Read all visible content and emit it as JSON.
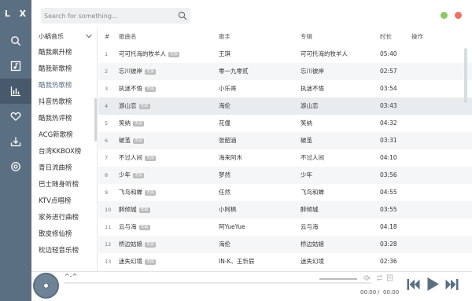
{
  "app": {
    "logo": "L X"
  },
  "nav": {
    "items": [
      "search",
      "song-list",
      "leaderboard",
      "favorites",
      "download",
      "settings"
    ]
  },
  "search": {
    "placeholder": "Search for something..."
  },
  "board": {
    "source": "小蜗音乐",
    "items": [
      "酷我飙升榜",
      "酷我新歌榜",
      "酷我热歌榜",
      "抖音热歌榜",
      "酷我热评榜",
      "ACG新歌榜",
      "台湾KKBOX榜",
      "青日流曲榜",
      "巴士随身听榜",
      "KTV点唱榜",
      "家务进行曲榜",
      "散皮修仙榜",
      "枕边轻音乐榜"
    ]
  },
  "table": {
    "headers": {
      "index": "#",
      "name": "歌曲名",
      "singer": "歌手",
      "album": "专辑",
      "duration": "时长",
      "ops": "操作"
    },
    "tag": "无损",
    "rows": [
      {
        "index": "1",
        "name": "可可托海的牧羊人",
        "tag": true,
        "singer": "王琪",
        "album": "可可托海的牧羊人",
        "duration": "05:40"
      },
      {
        "index": "2",
        "name": "忘川彼岸",
        "tag": true,
        "singer": "零一九零贰",
        "album": "忘川彼岸",
        "duration": "02:57"
      },
      {
        "index": "3",
        "name": "执迷不悟",
        "tag": true,
        "singer": "小乐哥",
        "album": "执迷不悟",
        "duration": "03:54"
      },
      {
        "index": "4",
        "name": "游山恋",
        "tag": true,
        "singer": "海伦",
        "album": "游山恋",
        "duration": "03:43"
      },
      {
        "index": "5",
        "name": "笑纳",
        "tag": true,
        "singer": "花僮",
        "album": "笑纳",
        "duration": "04:32"
      },
      {
        "index": "6",
        "name": "破茧",
        "tag": true,
        "singer": "张韶涵",
        "album": "破茧",
        "duration": "03:31"
      },
      {
        "index": "7",
        "name": "不过人间",
        "tag": true,
        "singer": "海来阿木",
        "album": "不过人间",
        "duration": "04:10"
      },
      {
        "index": "8",
        "name": "少年",
        "tag": true,
        "singer": "梦然",
        "album": "少年",
        "duration": "03:56"
      },
      {
        "index": "9",
        "name": "飞鸟和蝉",
        "tag": true,
        "singer": "任然",
        "album": "飞鸟和蝉",
        "duration": "04:55"
      },
      {
        "index": "10",
        "name": "醉倾城",
        "tag": true,
        "singer": "小阿枫",
        "album": "醉倾城",
        "duration": "03:55"
      },
      {
        "index": "11",
        "name": "云与海",
        "tag": true,
        "singer": "阿YueYue",
        "album": "云与海",
        "duration": "04:18"
      },
      {
        "index": "12",
        "name": "桥边姑娘",
        "tag": true,
        "singer": "海伦",
        "album": "桥边姑娘",
        "duration": "03:28"
      },
      {
        "index": "13",
        "name": "迷失幻境",
        "tag": true,
        "singer": "IN-K、王忻辰",
        "album": "迷失幻境",
        "duration": "02:36"
      }
    ]
  },
  "player": {
    "title": "^-^",
    "time_current": "00:00",
    "time_sep": "/",
    "time_total": "00:00",
    "progress": 0
  },
  "colors": {
    "sidebar": "#5b6f82",
    "minimize": "#8cc964",
    "close": "#f0715e",
    "icon": "#5b6f82"
  }
}
